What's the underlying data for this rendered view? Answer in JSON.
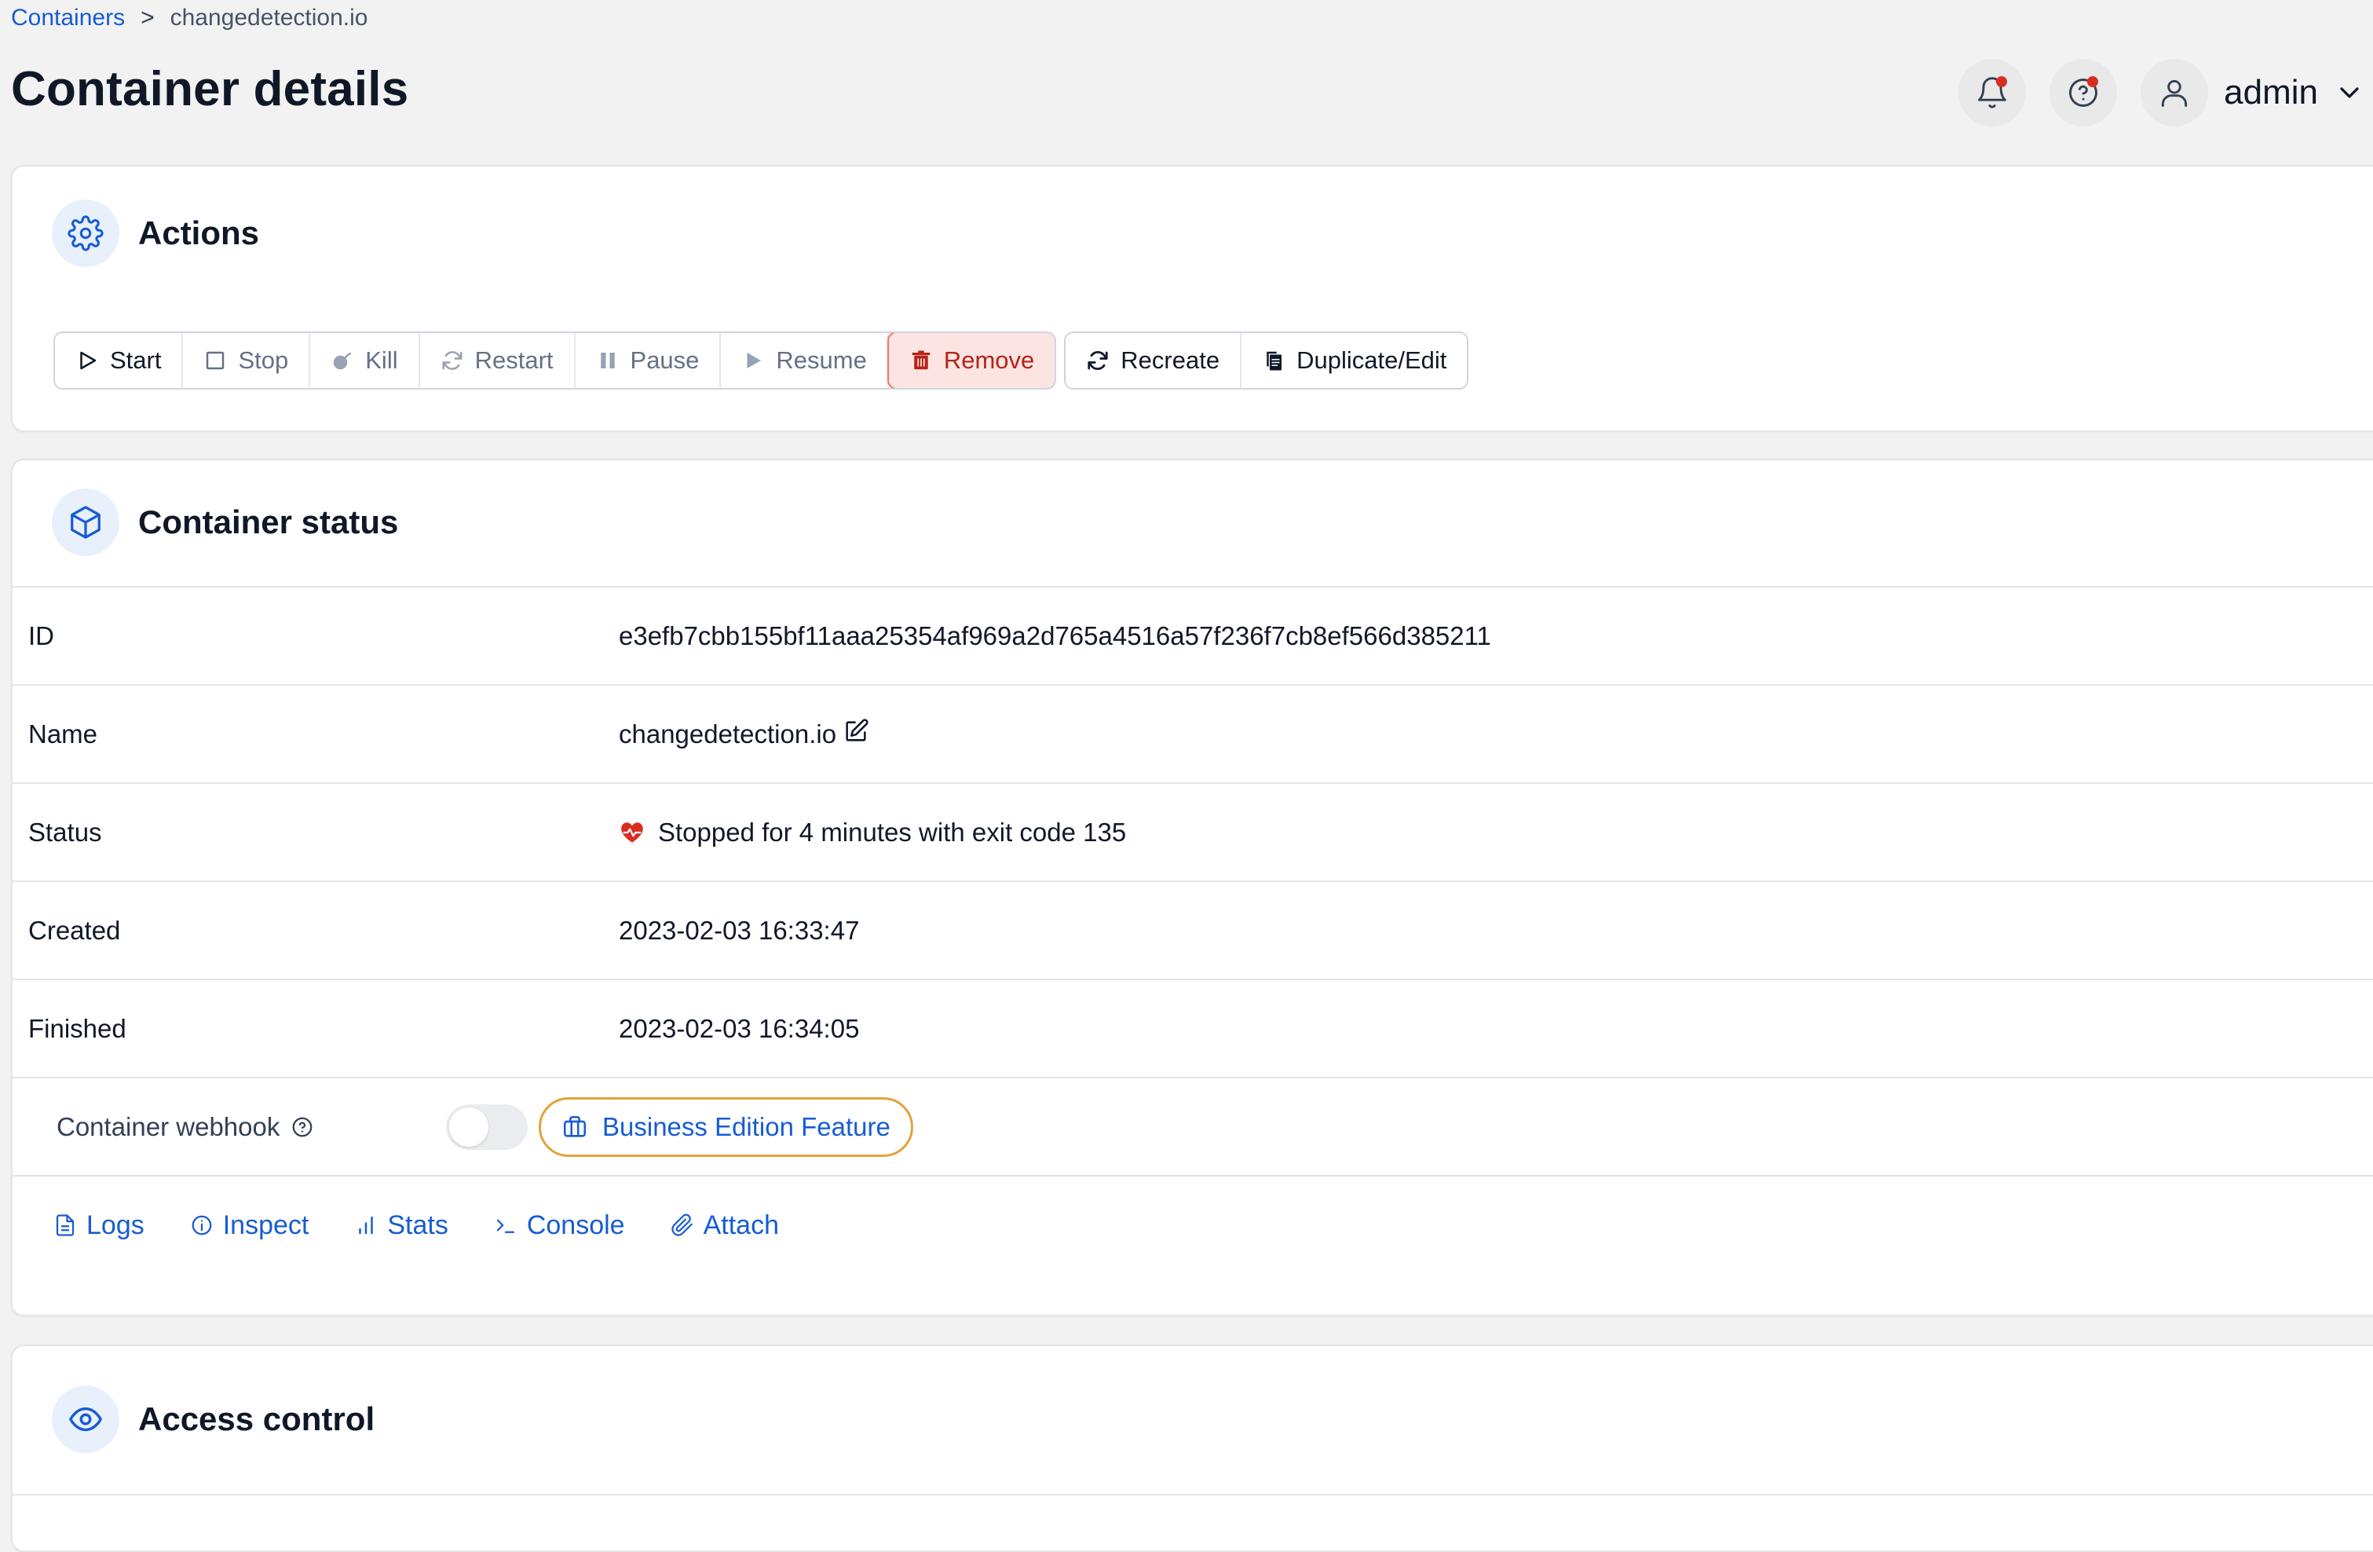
{
  "breadcrumb": {
    "parent": "Containers",
    "separator": ">",
    "current": "changedetection.io"
  },
  "page": {
    "title": "Container details"
  },
  "header": {
    "user_name": "admin"
  },
  "actions": {
    "title": "Actions",
    "buttons": {
      "start": "Start",
      "stop": "Stop",
      "kill": "Kill",
      "restart": "Restart",
      "pause": "Pause",
      "resume": "Resume",
      "remove": "Remove",
      "recreate": "Recreate",
      "duplicate": "Duplicate/Edit"
    }
  },
  "status_card": {
    "title": "Container status",
    "rows": {
      "id": {
        "label": "ID",
        "value": "e3efb7cbb155bf11aaa25354af969a2d765a4516a57f236f7cb8ef566d385211"
      },
      "name": {
        "label": "Name",
        "value": "changedetection.io"
      },
      "status": {
        "label": "Status",
        "value": "Stopped for 4 minutes with exit code 135"
      },
      "created": {
        "label": "Created",
        "value": "2023-02-03 16:33:47"
      },
      "finished": {
        "label": "Finished",
        "value": "2023-02-03 16:34:05"
      }
    },
    "webhook": {
      "label": "Container webhook",
      "enabled": false,
      "badge": "Business Edition Feature"
    },
    "links": {
      "logs": "Logs",
      "inspect": "Inspect",
      "stats": "Stats",
      "console": "Console",
      "attach": "Attach"
    }
  },
  "access_card": {
    "title": "Access control"
  },
  "colors": {
    "link": "#175cd3",
    "danger": "#b42318",
    "danger_bg": "#fce4e2",
    "badge_border": "#e2a33a",
    "status_icon": "#d92d20"
  }
}
